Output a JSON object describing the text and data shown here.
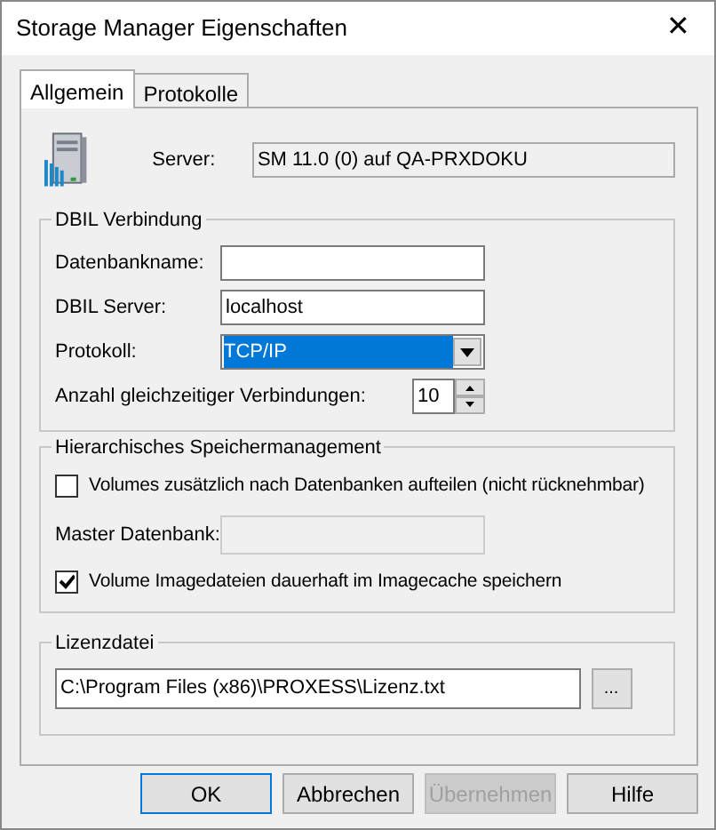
{
  "window": {
    "title": "Storage Manager Eigenschaften",
    "close": "✕"
  },
  "tabs": [
    {
      "label": "Allgemein",
      "selected": true
    },
    {
      "label": "Protokolle",
      "selected": false
    }
  ],
  "server": {
    "label": "Server:",
    "value": "SM 11.0 (0) auf QA-PRXDOKU"
  },
  "dbil": {
    "title": "DBIL Verbindung",
    "fields": [
      {
        "kind": "text",
        "label": "Datenbankname:"
      },
      {
        "kind": "text",
        "label": "DBIL Server:",
        "value": "localhost"
      },
      {
        "kind": "select",
        "label": "Protokoll:",
        "value": "TCP/IP",
        "highlighted": true
      },
      {
        "kind": "spin",
        "label": "Anzahl gleichzeitiger Verbindungen:",
        "value": "10"
      }
    ]
  },
  "hsm": {
    "title": "Hierarchisches Speichermanagement",
    "rows": [
      {
        "kind": "checkbox",
        "label": "Volumes zusätzlich nach Datenbanken aufteilen (nicht rücknehmbar)",
        "checked": false
      },
      {
        "kind": "field",
        "label": "Master Datenbank:",
        "disabled": true
      },
      {
        "kind": "checkbox",
        "label": "Volume Imagedateien dauerhaft im Imagecache speichern",
        "checked": true
      }
    ]
  },
  "license": {
    "title": "Lizenzdatei",
    "value": "C:\\Program Files (x86)\\PROXESS\\Lizenz.txt",
    "browse": "..."
  },
  "buttons": [
    {
      "label": "OK",
      "disabled": false,
      "default": true
    },
    {
      "label": "Abbrechen",
      "disabled": false,
      "default": false
    },
    {
      "label": "Übernehmen",
      "disabled": true,
      "default": false
    },
    {
      "label": "Hilfe",
      "disabled": false,
      "default": false
    }
  ]
}
